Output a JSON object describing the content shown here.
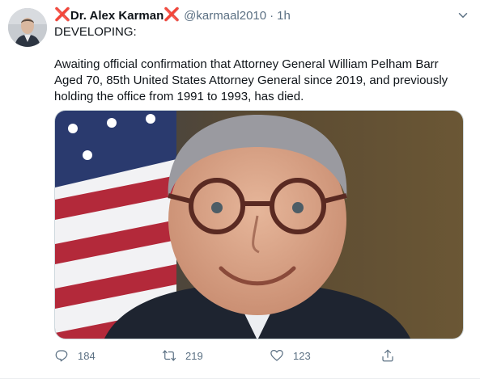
{
  "author": {
    "name_prefix_mark": "❌",
    "name": "Dr. Alex Karman",
    "name_suffix_mark": "❌",
    "handle": "@karmaal2010",
    "separator": "·",
    "time": "1h"
  },
  "tweet": {
    "line1": "DEVELOPING:",
    "line2": "Awaiting official confirmation that Attorney General William Pelham Barr Aged 70, 85th United States Attorney General since 2019, and previously holding the office from 1991 to 1993, has died."
  },
  "actions": {
    "reply_count": "184",
    "retweet_count": "219",
    "like_count": "123"
  },
  "icons": {
    "caret": "chevron-down-icon",
    "reply": "reply-icon",
    "retweet": "retweet-icon",
    "like": "heart-icon",
    "share": "share-icon"
  },
  "colors": {
    "text": "#0f1419",
    "secondary": "#5b7083",
    "red_mark": "#e0245e",
    "border": "#cfd9de"
  }
}
